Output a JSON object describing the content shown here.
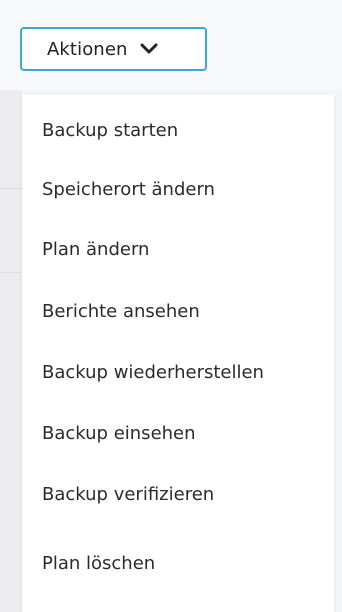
{
  "actions_button": {
    "label": "Aktionen",
    "icon": "chevron-down-icon"
  },
  "menu": {
    "items": [
      {
        "label": "Backup starten"
      },
      {
        "label": "Speicherort ändern"
      },
      {
        "label": "Plan ändern"
      },
      {
        "label": "Berichte ansehen"
      },
      {
        "label": "Backup wiederherstellen"
      },
      {
        "label": "Backup einsehen"
      },
      {
        "label": "Backup verifizieren"
      },
      {
        "label": "Plan löschen"
      }
    ]
  },
  "colors": {
    "accent_border": "#3ba8d9",
    "text": "#2b2b2b",
    "menu_background": "#ffffff"
  }
}
